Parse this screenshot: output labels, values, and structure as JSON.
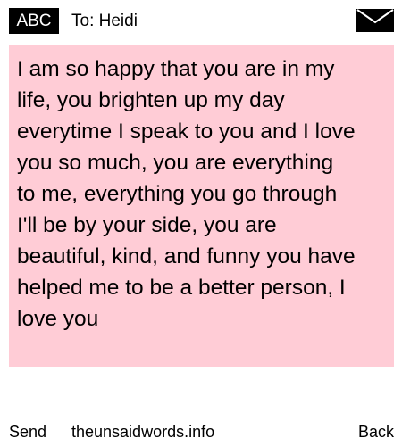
{
  "header": {
    "input_mode": "ABC",
    "recipient": "To: Heidi",
    "envelope_icon": "envelope-icon"
  },
  "message": {
    "text": " I am so happy that you are in my\nlife, you brighten up my day\neverytime I speak to you and I love\nyou so much, you are everything\nto me, everything you go through\nI'll be by your side, you are\nbeautiful, kind, and funny you have\nhelped me to be a better person, I\nlove you",
    "background_color": "#ffccd6"
  },
  "footer": {
    "send_label": "Send",
    "site_label": "theunsaidwords.info",
    "back_label": "Back"
  }
}
